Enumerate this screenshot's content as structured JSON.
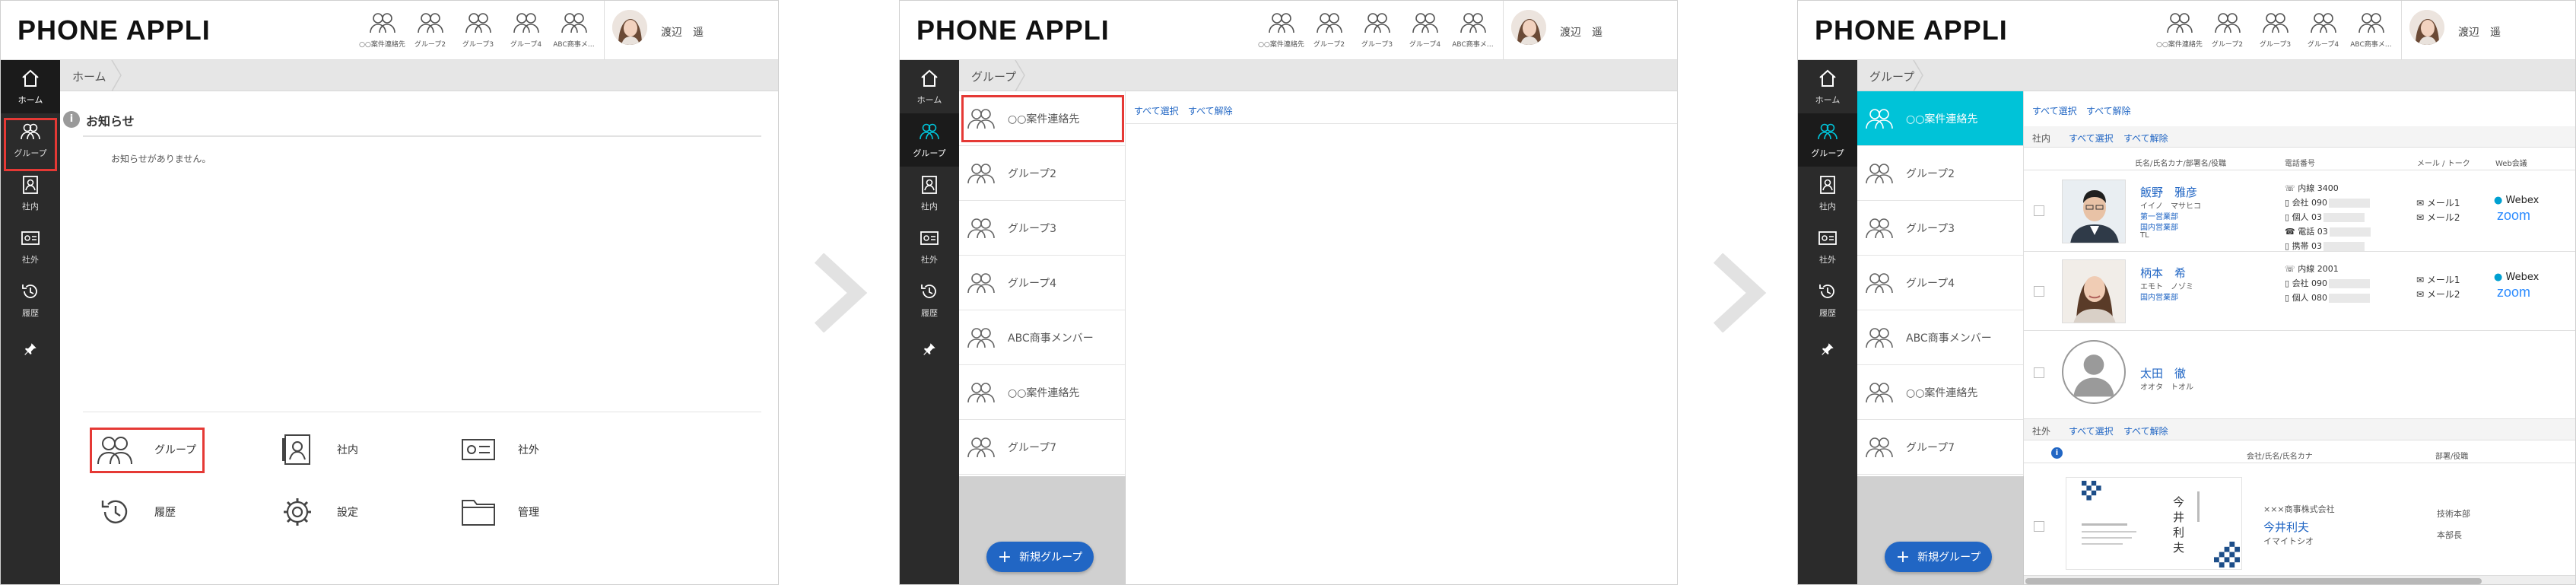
{
  "app": {
    "logo": "PHONE APPLI",
    "favorites": [
      "○○案件連絡先",
      "グループ2",
      "グループ3",
      "グループ4",
      "ABC商事メ…"
    ],
    "user_name": "渡辺　遥",
    "nav": [
      "ホーム",
      "グループ",
      "社内",
      "社外",
      "履歴"
    ]
  },
  "panel1": {
    "breadcrumb": "ホーム",
    "notice_title": "お知らせ",
    "notice_text": "お知らせがありません。",
    "menu": [
      {
        "label": "グループ",
        "icon": "group-icon"
      },
      {
        "label": "社内",
        "icon": "internal-directory-icon"
      },
      {
        "label": "社外",
        "icon": "business-card-icon"
      },
      {
        "label": "履歴",
        "icon": "history-icon"
      },
      {
        "label": "設定",
        "icon": "settings-icon"
      },
      {
        "label": "管理",
        "icon": "folder-icon"
      }
    ]
  },
  "panel2": {
    "breadcrumb": "グループ",
    "groups": [
      "○○案件連絡先",
      "グループ2",
      "グループ3",
      "グループ4",
      "ABC商事メンバー",
      "○○案件連絡先",
      "グループ7"
    ],
    "select_all": "すべて選択",
    "deselect_all": "すべて解除",
    "new_group": "新規グループ"
  },
  "panel3": {
    "breadcrumb": "グループ",
    "groups": [
      "○○案件連絡先",
      "グループ2",
      "グループ3",
      "グループ4",
      "ABC商事メンバー",
      "○○案件連絡先",
      "グループ7"
    ],
    "select_all": "すべて選択",
    "deselect_all": "すべて解除",
    "new_group": "新規グループ",
    "internal_label": "社内",
    "external_label": "社外",
    "col_name": "氏名/氏名カナ/部署名/役職",
    "col_phone": "電話番号",
    "col_mail": "メール / トーク",
    "col_web": "Web会議",
    "col_company": "会社/氏名/氏名カナ",
    "col_dept": "部署/役職",
    "contacts": [
      {
        "name": "飯野　雅彦",
        "kana": "イイノ　マサヒコ",
        "dept1": "第一営業部",
        "dept2": "国内営業部",
        "title": "TL",
        "phones": [
          "内線  3400",
          "会社  090",
          "個人  03",
          "電話  03",
          "携帯  03"
        ],
        "mail1": "メール1",
        "mail2": "メール2"
      },
      {
        "name": "柄本　希",
        "kana": "エモト　ノゾミ",
        "dept1": "国内営業部",
        "phones": [
          "内線  2001",
          "会社  090",
          "個人  080"
        ],
        "mail1": "メール1",
        "mail2": "メール2"
      },
      {
        "name": "太田　徹",
        "kana": "オオタ　トオル"
      }
    ],
    "web": [
      "Webex",
      "zoom"
    ],
    "external": {
      "company": "×××商事株式会社",
      "name": "今井利夫",
      "kana": "イマイトシオ",
      "dept": "技術本部",
      "title": "本部長",
      "card_name": "今井 利夫"
    }
  },
  "colors": {
    "accent": "#00c3d8",
    "link": "#2166c4",
    "nav": "#2b2b2b",
    "highlight": "#e53935"
  }
}
